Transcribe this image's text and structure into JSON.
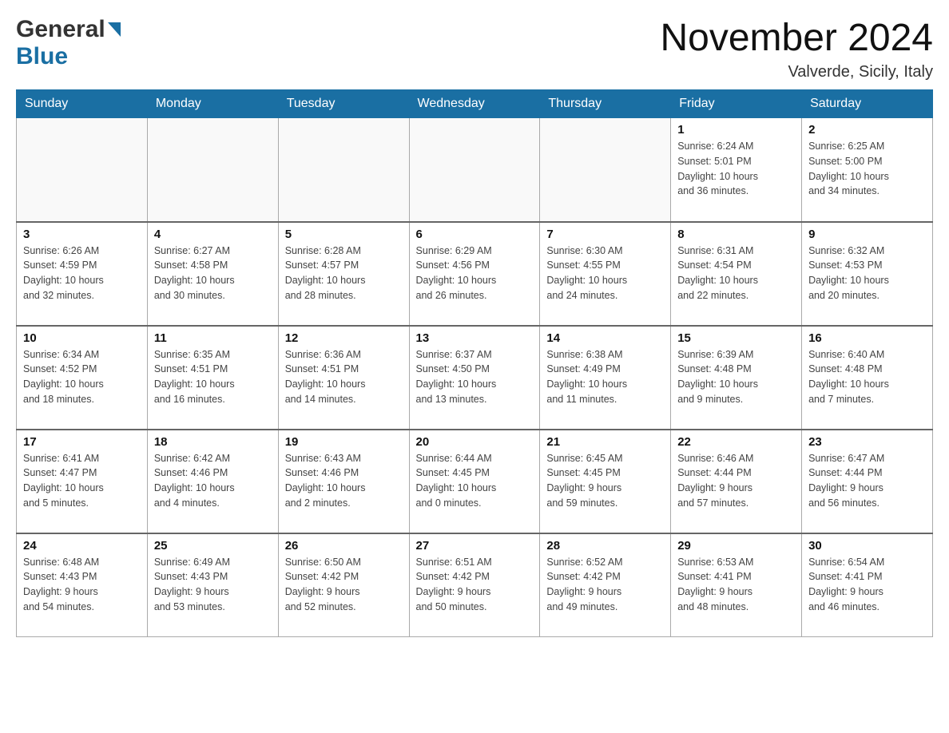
{
  "logo": {
    "general": "General",
    "blue": "Blue"
  },
  "title": "November 2024",
  "location": "Valverde, Sicily, Italy",
  "weekdays": [
    "Sunday",
    "Monday",
    "Tuesday",
    "Wednesday",
    "Thursday",
    "Friday",
    "Saturday"
  ],
  "weeks": [
    {
      "days": [
        {
          "num": "",
          "info": ""
        },
        {
          "num": "",
          "info": ""
        },
        {
          "num": "",
          "info": ""
        },
        {
          "num": "",
          "info": ""
        },
        {
          "num": "",
          "info": ""
        },
        {
          "num": "1",
          "info": "Sunrise: 6:24 AM\nSunset: 5:01 PM\nDaylight: 10 hours\nand 36 minutes."
        },
        {
          "num": "2",
          "info": "Sunrise: 6:25 AM\nSunset: 5:00 PM\nDaylight: 10 hours\nand 34 minutes."
        }
      ]
    },
    {
      "days": [
        {
          "num": "3",
          "info": "Sunrise: 6:26 AM\nSunset: 4:59 PM\nDaylight: 10 hours\nand 32 minutes."
        },
        {
          "num": "4",
          "info": "Sunrise: 6:27 AM\nSunset: 4:58 PM\nDaylight: 10 hours\nand 30 minutes."
        },
        {
          "num": "5",
          "info": "Sunrise: 6:28 AM\nSunset: 4:57 PM\nDaylight: 10 hours\nand 28 minutes."
        },
        {
          "num": "6",
          "info": "Sunrise: 6:29 AM\nSunset: 4:56 PM\nDaylight: 10 hours\nand 26 minutes."
        },
        {
          "num": "7",
          "info": "Sunrise: 6:30 AM\nSunset: 4:55 PM\nDaylight: 10 hours\nand 24 minutes."
        },
        {
          "num": "8",
          "info": "Sunrise: 6:31 AM\nSunset: 4:54 PM\nDaylight: 10 hours\nand 22 minutes."
        },
        {
          "num": "9",
          "info": "Sunrise: 6:32 AM\nSunset: 4:53 PM\nDaylight: 10 hours\nand 20 minutes."
        }
      ]
    },
    {
      "days": [
        {
          "num": "10",
          "info": "Sunrise: 6:34 AM\nSunset: 4:52 PM\nDaylight: 10 hours\nand 18 minutes."
        },
        {
          "num": "11",
          "info": "Sunrise: 6:35 AM\nSunset: 4:51 PM\nDaylight: 10 hours\nand 16 minutes."
        },
        {
          "num": "12",
          "info": "Sunrise: 6:36 AM\nSunset: 4:51 PM\nDaylight: 10 hours\nand 14 minutes."
        },
        {
          "num": "13",
          "info": "Sunrise: 6:37 AM\nSunset: 4:50 PM\nDaylight: 10 hours\nand 13 minutes."
        },
        {
          "num": "14",
          "info": "Sunrise: 6:38 AM\nSunset: 4:49 PM\nDaylight: 10 hours\nand 11 minutes."
        },
        {
          "num": "15",
          "info": "Sunrise: 6:39 AM\nSunset: 4:48 PM\nDaylight: 10 hours\nand 9 minutes."
        },
        {
          "num": "16",
          "info": "Sunrise: 6:40 AM\nSunset: 4:48 PM\nDaylight: 10 hours\nand 7 minutes."
        }
      ]
    },
    {
      "days": [
        {
          "num": "17",
          "info": "Sunrise: 6:41 AM\nSunset: 4:47 PM\nDaylight: 10 hours\nand 5 minutes."
        },
        {
          "num": "18",
          "info": "Sunrise: 6:42 AM\nSunset: 4:46 PM\nDaylight: 10 hours\nand 4 minutes."
        },
        {
          "num": "19",
          "info": "Sunrise: 6:43 AM\nSunset: 4:46 PM\nDaylight: 10 hours\nand 2 minutes."
        },
        {
          "num": "20",
          "info": "Sunrise: 6:44 AM\nSunset: 4:45 PM\nDaylight: 10 hours\nand 0 minutes."
        },
        {
          "num": "21",
          "info": "Sunrise: 6:45 AM\nSunset: 4:45 PM\nDaylight: 9 hours\nand 59 minutes."
        },
        {
          "num": "22",
          "info": "Sunrise: 6:46 AM\nSunset: 4:44 PM\nDaylight: 9 hours\nand 57 minutes."
        },
        {
          "num": "23",
          "info": "Sunrise: 6:47 AM\nSunset: 4:44 PM\nDaylight: 9 hours\nand 56 minutes."
        }
      ]
    },
    {
      "days": [
        {
          "num": "24",
          "info": "Sunrise: 6:48 AM\nSunset: 4:43 PM\nDaylight: 9 hours\nand 54 minutes."
        },
        {
          "num": "25",
          "info": "Sunrise: 6:49 AM\nSunset: 4:43 PM\nDaylight: 9 hours\nand 53 minutes."
        },
        {
          "num": "26",
          "info": "Sunrise: 6:50 AM\nSunset: 4:42 PM\nDaylight: 9 hours\nand 52 minutes."
        },
        {
          "num": "27",
          "info": "Sunrise: 6:51 AM\nSunset: 4:42 PM\nDaylight: 9 hours\nand 50 minutes."
        },
        {
          "num": "28",
          "info": "Sunrise: 6:52 AM\nSunset: 4:42 PM\nDaylight: 9 hours\nand 49 minutes."
        },
        {
          "num": "29",
          "info": "Sunrise: 6:53 AM\nSunset: 4:41 PM\nDaylight: 9 hours\nand 48 minutes."
        },
        {
          "num": "30",
          "info": "Sunrise: 6:54 AM\nSunset: 4:41 PM\nDaylight: 9 hours\nand 46 minutes."
        }
      ]
    }
  ]
}
